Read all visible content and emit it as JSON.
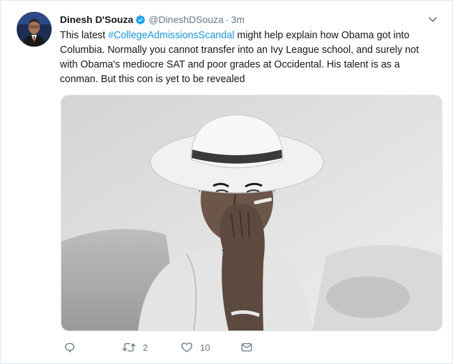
{
  "tweet": {
    "author_name": "Dinesh D'Souza",
    "handle": "@DineshDSouza",
    "separator": "·",
    "time": "3m",
    "text_before": "This latest ",
    "hashtag": "#CollegeAdmissionsScandal",
    "text_after": " might help explain how Obama got into Columbia. Normally you cannot transfer into an Ivy League school, and surely not with Obama's mediocre SAT and poor grades at Occidental. His talent is as a conman. But this con is yet to be revealed"
  },
  "actions": {
    "reply_count": "",
    "retweet_count": "2",
    "like_count": "10"
  },
  "colors": {
    "link": "#1b95e0",
    "muted": "#657786",
    "verified": "#1da1f2"
  },
  "icons": {
    "verified": "verified-badge-icon",
    "caret": "chevron-down-icon",
    "reply": "reply-icon",
    "retweet": "retweet-icon",
    "like": "heart-icon",
    "dm": "envelope-icon"
  }
}
